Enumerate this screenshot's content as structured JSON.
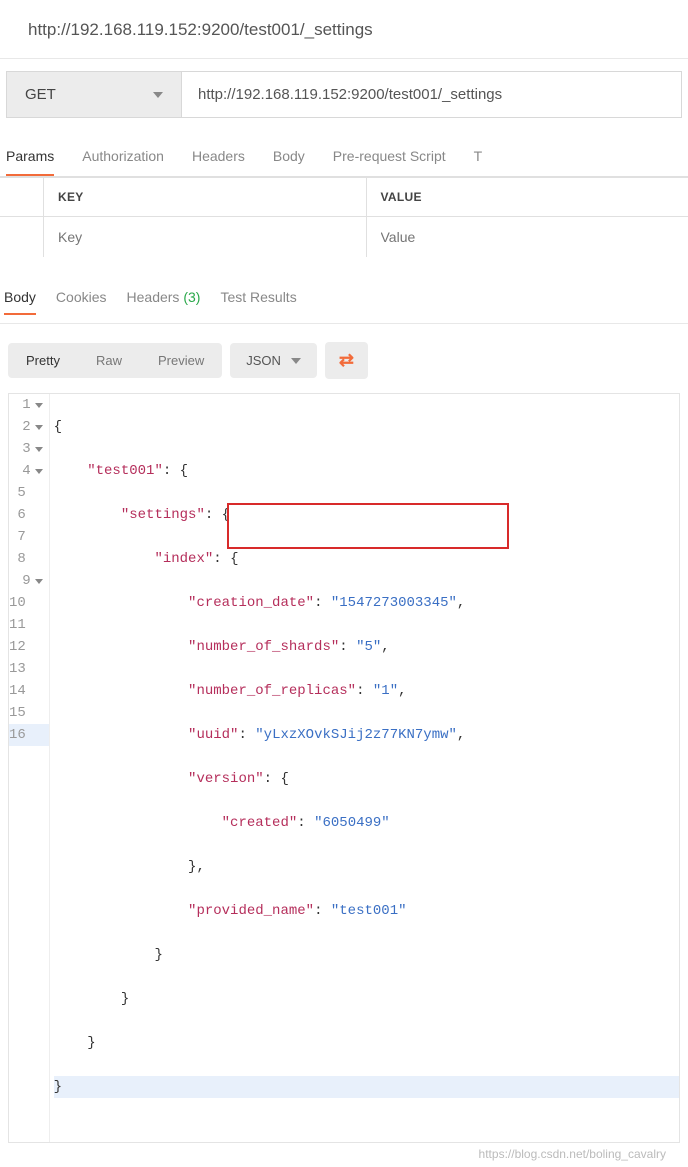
{
  "url_title": "http://192.168.119.152:9200/test001/_settings",
  "request": {
    "method": "GET",
    "url": "http://192.168.119.152:9200/test001/_settings"
  },
  "tabs": {
    "params": "Params",
    "auth": "Authorization",
    "headers": "Headers",
    "body": "Body",
    "prereq": "Pre-request Script",
    "tests": "T"
  },
  "kv": {
    "key_header": "KEY",
    "value_header": "VALUE",
    "key_placeholder": "Key",
    "value_placeholder": "Value"
  },
  "response_tabs": {
    "body": "Body",
    "cookies": "Cookies",
    "headers": "Headers",
    "headers_count": "(3)",
    "test_results": "Test Results"
  },
  "view": {
    "pretty": "Pretty",
    "raw": "Raw",
    "preview": "Preview",
    "format": "JSON"
  },
  "json": {
    "index_name": "test001",
    "settings_key": "settings",
    "index_key": "index",
    "creation_date_key": "creation_date",
    "creation_date_val": "1547273003345",
    "shards_key": "number_of_shards",
    "shards_val": "5",
    "replicas_key": "number_of_replicas",
    "replicas_val": "1",
    "uuid_key": "uuid",
    "uuid_val": "yLxzXOvkSJij2z77KN7ymw",
    "version_key": "version",
    "created_key": "created",
    "created_val": "6050499",
    "provided_name_key": "provided_name",
    "provided_name_val": "test001"
  },
  "watermark": "https://blog.csdn.net/boling_cavalry"
}
